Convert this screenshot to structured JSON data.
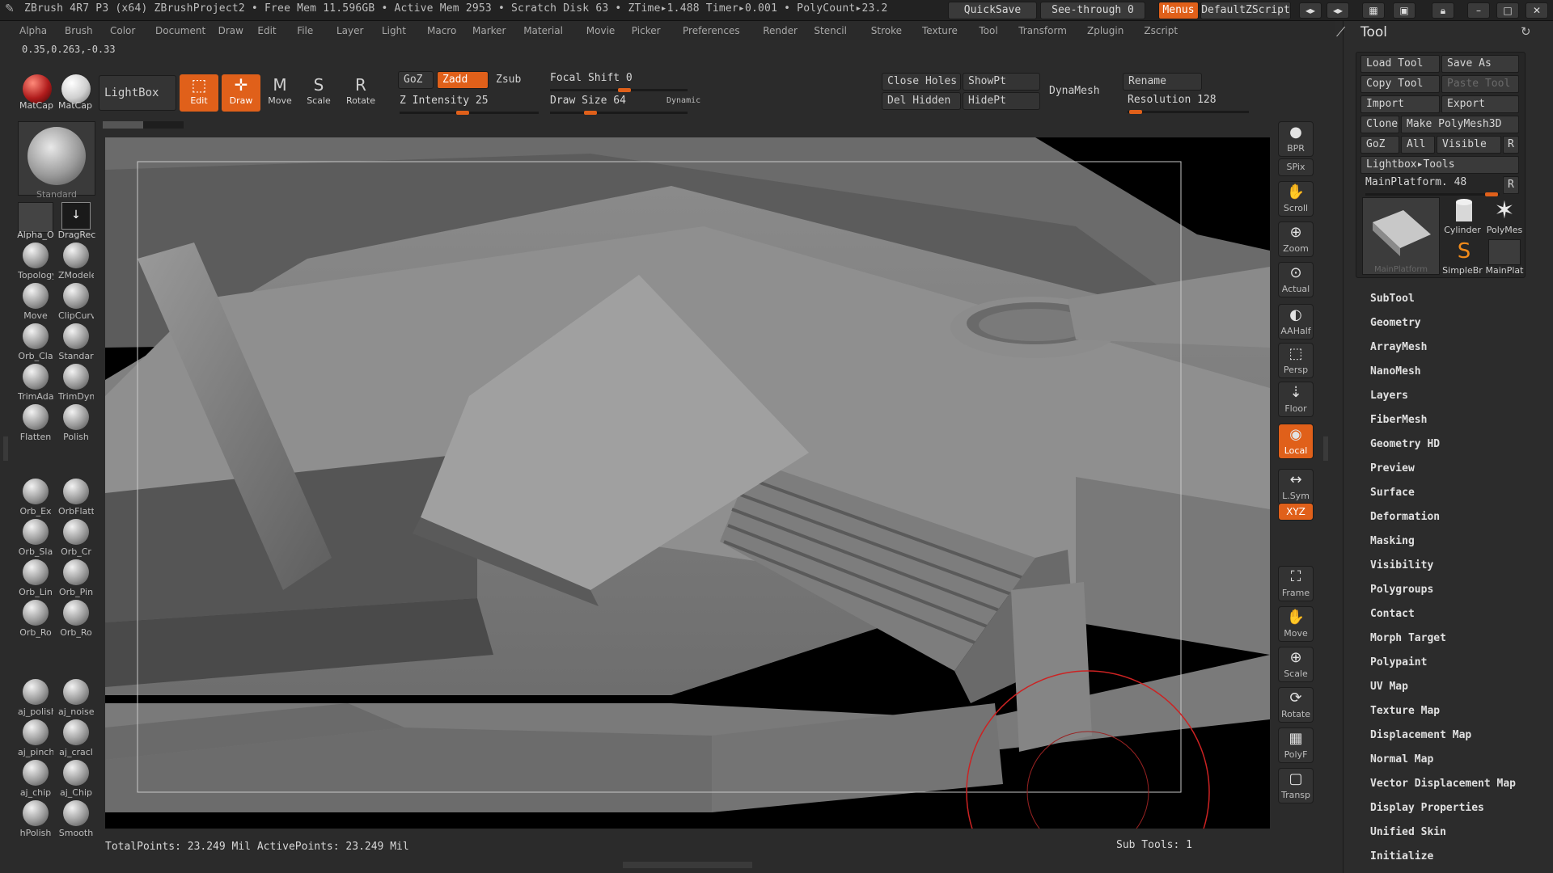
{
  "titlebar": {
    "title": "ZBrush 4R7 P3 (x64)   ZBrushProject2    • Free Mem 11.596GB • Active Mem 2953 • Scratch Disk 63 •  ZTime▸1.488 Timer▸0.001 • PolyCount▸23.2",
    "quicksave": "QuickSave",
    "see_through": "See-through  0",
    "menus": "Menus",
    "default_zscript": "DefaultZScript"
  },
  "menubar": [
    "Alpha",
    "Brush",
    "Color",
    "Document",
    "Draw",
    "Edit",
    "File",
    "Layer",
    "Light",
    "Macro",
    "Marker",
    "Material",
    "Movie",
    "Picker",
    "Preferences",
    "Render",
    "Stencil",
    "Stroke",
    "Texture",
    "Tool",
    "Transform",
    "Zplugin",
    "Zscript"
  ],
  "coords": "0.35,0.263,-0.33",
  "shelf": {
    "matcap1": "MatCap",
    "matcap2": "MatCap",
    "lightbox": "LightBox",
    "edit": "Edit",
    "draw": "Draw",
    "move": "Move",
    "scale": "Scale",
    "rotate": "Rotate",
    "goz": "GoZ",
    "zadd": "Zadd",
    "zsub": "Zsub",
    "z_intensity": "Z Intensity 25",
    "z_intensity_value": 25,
    "focal_shift": "Focal Shift 0",
    "draw_size": "Draw Size 64",
    "dynamic": "Dynamic",
    "close_holes": "Close Holes",
    "show_pt": "ShowPt",
    "del_hidden": "Del Hidden",
    "hide_pt": "HidePt",
    "dynamesh": "DynaMesh",
    "rename": "Rename",
    "resolution": "Resolution 128"
  },
  "left_palette": {
    "standard": "Standard",
    "alpha": "Alpha_O",
    "dragrect": "DragRec",
    "brushes": [
      [
        "Topology",
        "ZModeler"
      ],
      [
        "Move",
        "ClipCurv"
      ],
      [
        "Orb_Cla",
        "Standar"
      ],
      [
        "TrimAda",
        "TrimDyn"
      ],
      [
        "Flatten",
        "Polish"
      ],
      [
        "Orb_Ex",
        "OrbFlatt"
      ],
      [
        "Orb_Sla",
        "Orb_Cr"
      ],
      [
        "Orb_Lin",
        "Orb_Pin"
      ],
      [
        "Orb_Ro",
        "Orb_Ro"
      ],
      [
        "aj_polish",
        "aj_noise"
      ],
      [
        "aj_pinch",
        "aj_cracl"
      ],
      [
        "aj_chip",
        "aj_Chip"
      ],
      [
        "hPolish",
        "Smooth"
      ]
    ]
  },
  "right_dock": [
    {
      "label": "BPR",
      "icon": "bpr-icon"
    },
    {
      "label": "SPix",
      "icon": "spix-icon"
    },
    {
      "label": "Scroll",
      "icon": "scroll-icon"
    },
    {
      "label": "Zoom",
      "icon": "zoom-icon"
    },
    {
      "label": "Actual",
      "icon": "actual-icon"
    },
    {
      "label": "AAHalf",
      "icon": "aahalf-icon"
    },
    {
      "label": "Persp",
      "icon": "persp-icon"
    },
    {
      "label": "Floor",
      "icon": "floor-icon"
    },
    {
      "label": "Local",
      "icon": "local-icon"
    },
    {
      "label": "L.Sym",
      "icon": "lsym-icon"
    },
    {
      "label": "XYZ",
      "icon": "xyz-icon"
    },
    {
      "label": "Frame",
      "icon": "frame-icon"
    },
    {
      "label": "Move",
      "icon": "move-icon"
    },
    {
      "label": "Scale",
      "icon": "scale-icon"
    },
    {
      "label": "Rotate",
      "icon": "rotate-icon"
    },
    {
      "label": "PolyF",
      "icon": "polyf-icon"
    },
    {
      "label": "Transp",
      "icon": "transp-icon"
    }
  ],
  "tool_panel": {
    "title": "Tool",
    "load_tool": "Load Tool",
    "save_as": "Save As",
    "copy_tool": "Copy Tool",
    "paste_tool": "Paste Tool",
    "import": "Import",
    "export": "Export",
    "clone": "Clone",
    "make_polymesh": "Make PolyMesh3D",
    "goz": "GoZ",
    "all": "All",
    "visible": "Visible",
    "r": "R",
    "lightbox_tools": "Lightbox▸Tools",
    "main_platform": "MainPlatform. 48",
    "thumbs": [
      "MainPlatform",
      "Cylinder",
      "PolyMes",
      "SimpleBr",
      "MainPlat"
    ],
    "sections": [
      "SubTool",
      "Geometry",
      "ArrayMesh",
      "NanoMesh",
      "Layers",
      "FiberMesh",
      "Geometry HD",
      "Preview",
      "Surface",
      "Deformation",
      "Masking",
      "Visibility",
      "Polygroups",
      "Contact",
      "Morph Target",
      "Polypaint",
      "UV Map",
      "Texture Map",
      "Displacement Map",
      "Normal Map",
      "Vector Displacement Map",
      "Display Properties",
      "Unified Skin",
      "Initialize"
    ]
  },
  "status": {
    "points": "TotalPoints: 23.249 Mil ActivePoints: 23.249 Mil",
    "subtools": "Sub Tools: 1"
  },
  "colors": {
    "accent": "#e0601a",
    "bg": "#2b2b2b",
    "viewport": "#404040",
    "brush_circle": "#cc2222"
  }
}
